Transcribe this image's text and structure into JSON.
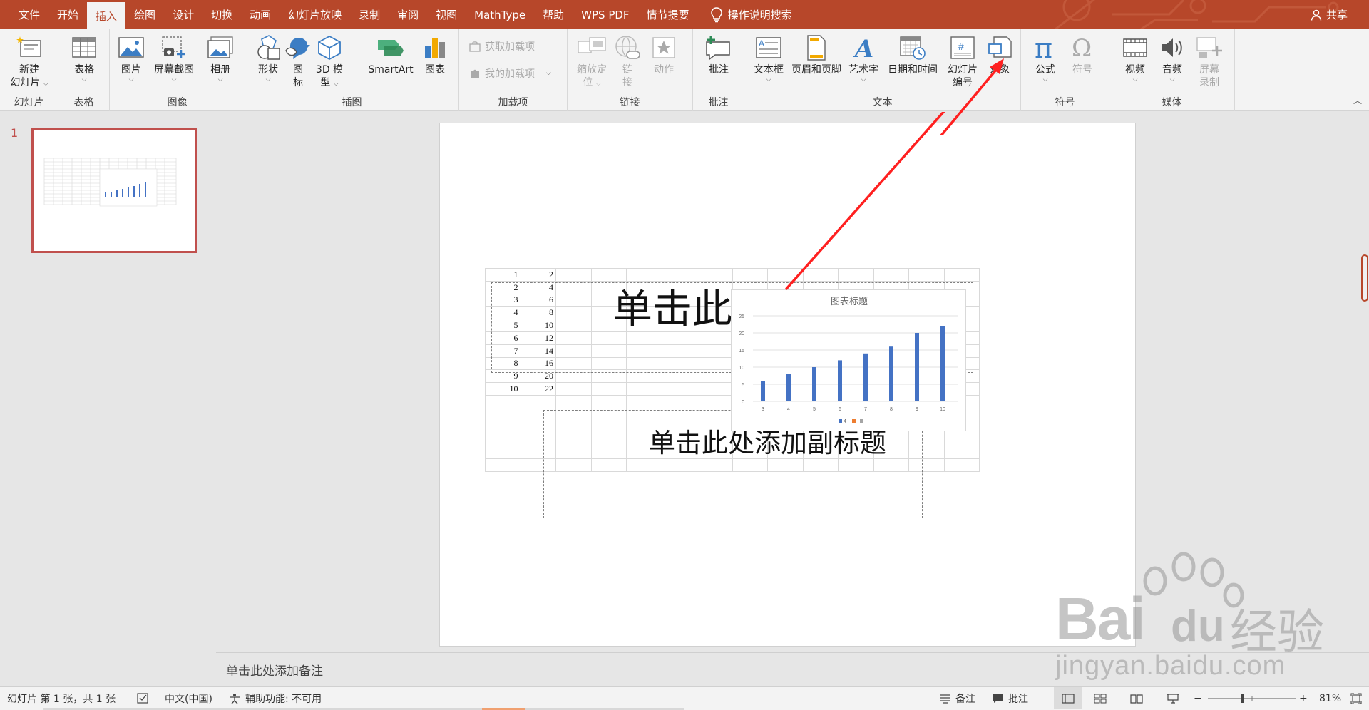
{
  "tabs": [
    "文件",
    "开始",
    "插入",
    "绘图",
    "设计",
    "切换",
    "动画",
    "幻灯片放映",
    "录制",
    "审阅",
    "视图",
    "MathType",
    "帮助",
    "WPS PDF",
    "情节提要"
  ],
  "active_tab": "插入",
  "tell_me": "操作说明搜索",
  "share": "共享",
  "ribbon": {
    "groups": {
      "slides": "幻灯片",
      "tables": "表格",
      "images": "图像",
      "illustrations": "插图",
      "addins": "加载项",
      "links": "链接",
      "comments": "批注",
      "text": "文本",
      "symbols": "符号",
      "media": "媒体"
    },
    "buttons": {
      "new_slide_1": "新建",
      "new_slide_2": "幻灯片",
      "table": "表格",
      "picture": "图片",
      "screenshot": "屏幕截图",
      "album": "相册",
      "shapes": "形状",
      "icons_1": "图",
      "icons_2": "标",
      "model3d_1": "3D 模",
      "model3d_2": "型",
      "smartart": "SmartArt",
      "chart": "图表",
      "get_addins": "获取加载项",
      "my_addins": "我的加载项",
      "zoom_1": "缩放定",
      "zoom_2": "位",
      "link_1": "链",
      "link_2": "接",
      "action": "动作",
      "comment": "批注",
      "textbox": "文本框",
      "header_footer": "页眉和页脚",
      "wordart": "艺术字",
      "datetime": "日期和时间",
      "slide_number_1": "幻灯片",
      "slide_number_2": "编号",
      "object": "对象",
      "equation": "公式",
      "symbol": "符号",
      "video": "视频",
      "audio": "音频",
      "screen_rec_1": "屏幕",
      "screen_rec_2": "录制"
    }
  },
  "thumbnail": {
    "number": "1"
  },
  "slide": {
    "title_placeholder": "单击此处添加标题",
    "subtitle_placeholder": "单击此处添加副标题",
    "table": {
      "rows": [
        [
          "1",
          "2"
        ],
        [
          "2",
          "4"
        ],
        [
          "3",
          "6"
        ],
        [
          "4",
          "8"
        ],
        [
          "5",
          "10"
        ],
        [
          "6",
          "12"
        ],
        [
          "7",
          "14"
        ],
        [
          "8",
          "16"
        ],
        [
          "9",
          "20"
        ],
        [
          "10",
          "22"
        ]
      ]
    }
  },
  "chart_data": {
    "type": "bar",
    "title": "图表标题",
    "categories": [
      "3",
      "4",
      "5",
      "6",
      "7",
      "8",
      "9",
      "10"
    ],
    "series": [
      {
        "name": "4",
        "values": [
          6,
          8,
          10,
          12,
          14,
          16,
          20,
          22
        ]
      }
    ],
    "ylim": [
      0,
      25
    ],
    "yticks": [
      0,
      5,
      10,
      15,
      20,
      25
    ],
    "grid": true,
    "legend": "bottom",
    "legend_entries": [
      "4",
      "",
      ""
    ],
    "colors": [
      "#4472c4",
      "#ed7d31",
      "#a5a5a5"
    ]
  },
  "notes": "单击此处添加备注",
  "status": {
    "slide_info": "幻灯片 第 1 张，共 1 张",
    "language": "中文(中国)",
    "accessibility": "辅助功能: 不可用",
    "notes_btn": "备注",
    "comments_btn": "批注",
    "zoom": "81%"
  },
  "watermark": {
    "brand": "Bai",
    "brand2": "du",
    "cn": "经验",
    "url": "jingyan.baidu.com"
  },
  "colors": {
    "accent": "#b7472a",
    "arrow": "#ff2020",
    "bar": "#4472c4"
  }
}
